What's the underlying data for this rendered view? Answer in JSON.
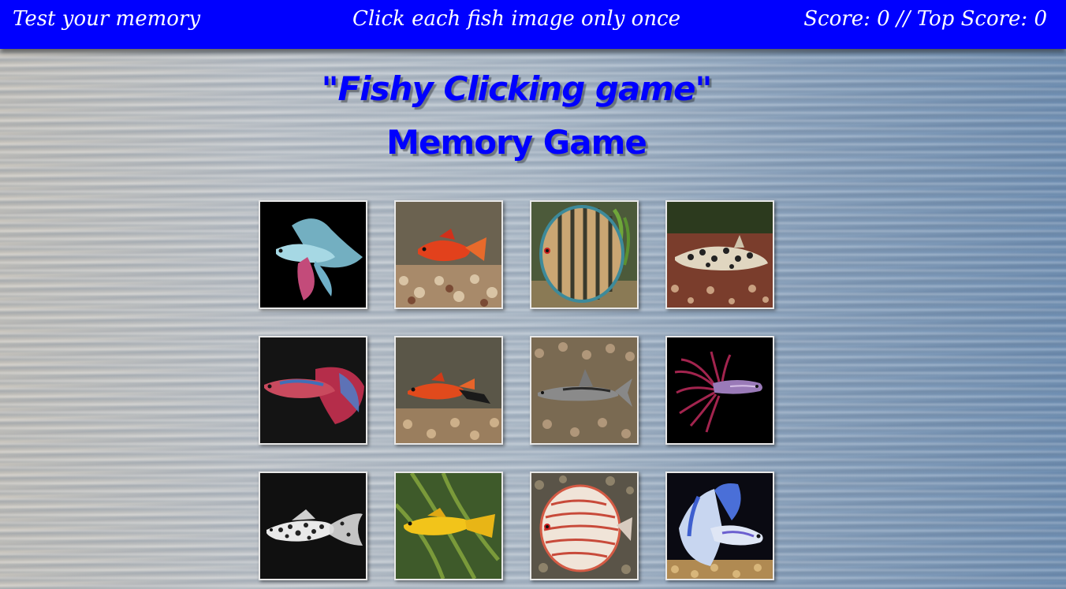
{
  "navbar": {
    "left": "Test your memory",
    "center": "Click each fish image only once",
    "score_label": "Score: 0 // Top Score: 0",
    "color": "#0000ff"
  },
  "header": {
    "title": "\"Fishy Clicking game\"",
    "subtitle": "Memory Game",
    "color": "#0000ff"
  },
  "cards": [
    {
      "fish": "betta-light-blue",
      "bg": "#000000"
    },
    {
      "fish": "platy-red",
      "bg": "#6b6250"
    },
    {
      "fish": "discus-striped",
      "bg": "#4c5a3a"
    },
    {
      "fish": "catfish-spotted",
      "bg": "#7a3d2c"
    },
    {
      "fish": "betta-red-blue",
      "bg": "#141414"
    },
    {
      "fish": "swordtail-red",
      "bg": "#5a5648"
    },
    {
      "fish": "catfish-silver",
      "bg": "#7a6a52"
    },
    {
      "fish": "betta-crowntail-purple",
      "bg": "#000000"
    },
    {
      "fish": "molly-dalmatian",
      "bg": "#101010"
    },
    {
      "fish": "platy-yellow",
      "bg": "#3e5a2a"
    },
    {
      "fish": "discus-red-white",
      "bg": "#5a5448"
    },
    {
      "fish": "betta-blue-white",
      "bg": "#0a0a12"
    }
  ]
}
